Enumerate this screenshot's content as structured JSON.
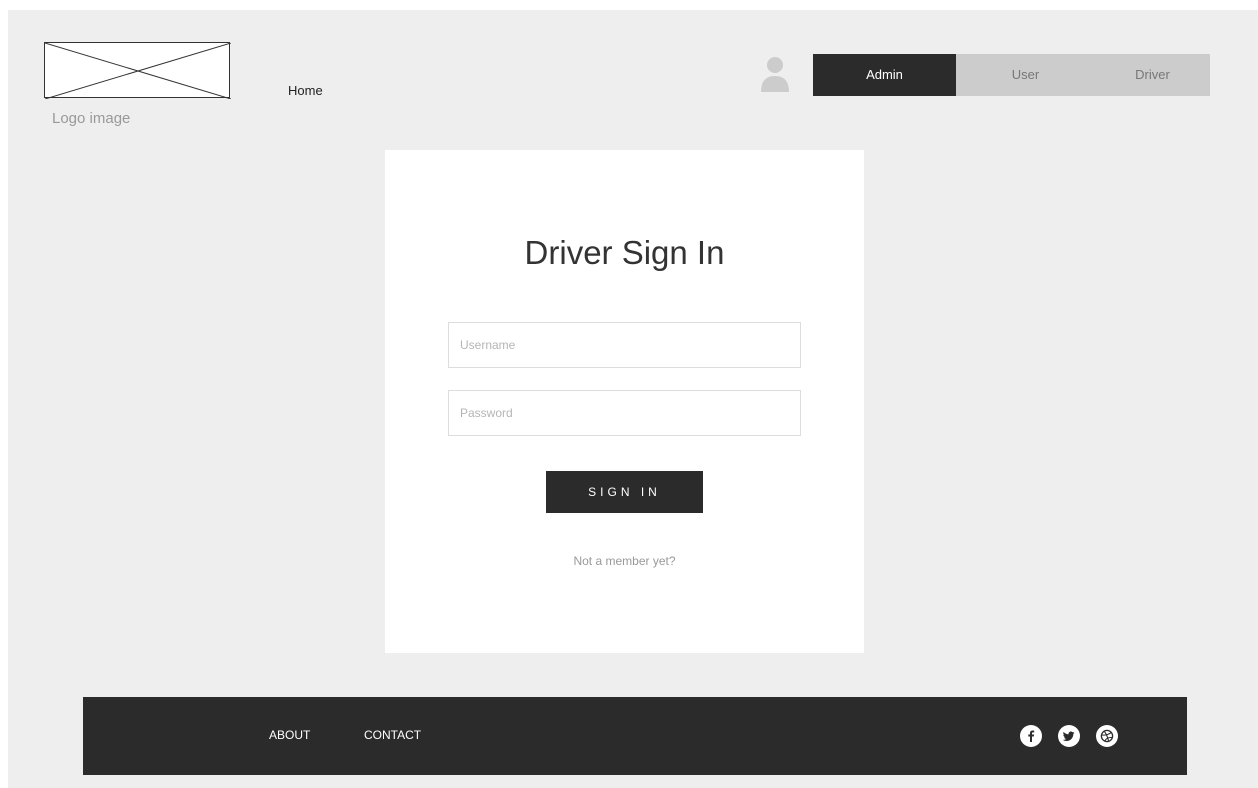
{
  "header": {
    "logo_caption": "Logo image",
    "nav": {
      "home_label": "Home"
    },
    "role_tabs": [
      {
        "label": "Admin",
        "active": true
      },
      {
        "label": "User",
        "active": false
      },
      {
        "label": "Driver",
        "active": false
      }
    ]
  },
  "login": {
    "title": "Driver Sign In",
    "username": {
      "placeholder": "Username",
      "value": ""
    },
    "password": {
      "placeholder": "Password",
      "value": ""
    },
    "signin_label": "SIGN IN",
    "member_link": "Not a member yet?"
  },
  "footer": {
    "links": [
      {
        "label": "ABOUT"
      },
      {
        "label": "CONTACT"
      }
    ],
    "social_icons": [
      "facebook-icon",
      "twitter-icon",
      "dribbble-icon"
    ]
  },
  "colors": {
    "background": "#eeeeee",
    "card": "#ffffff",
    "dark": "#2b2b2b",
    "tab_inactive": "#cccccc",
    "muted_text": "#999999"
  }
}
